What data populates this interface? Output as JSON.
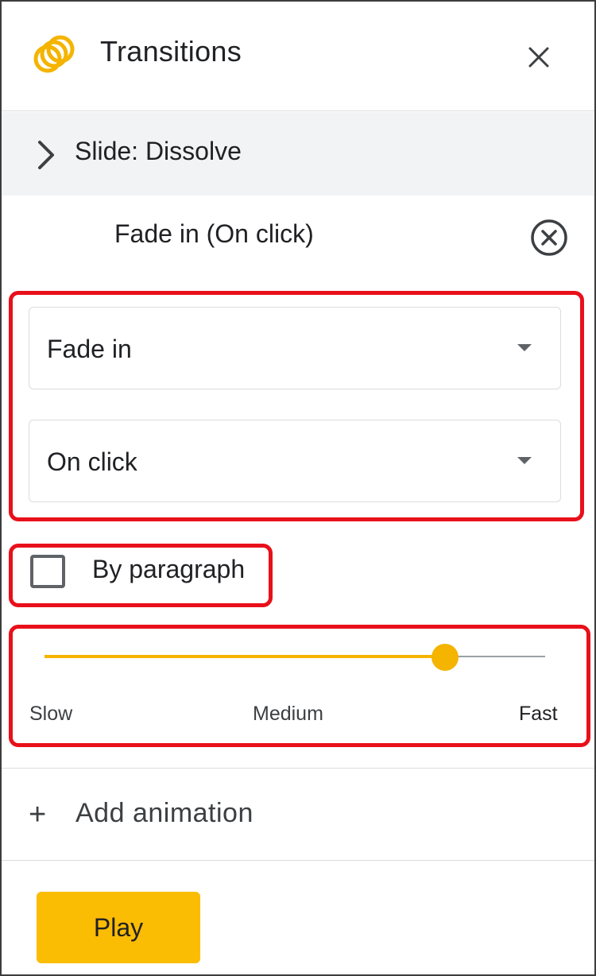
{
  "header": {
    "title": "Transitions",
    "icon": "transitions-icon",
    "close_icon": "close-icon"
  },
  "slide": {
    "label": "Slide: Dissolve",
    "expand_icon": "chevron-right-icon"
  },
  "animation": {
    "title": "Fade in  (On click)",
    "remove_icon": "circle-close-icon",
    "effect_select": {
      "value": "Fade in"
    },
    "trigger_select": {
      "value": "On click"
    },
    "by_paragraph": {
      "label": "By paragraph",
      "checked": false
    },
    "speed": {
      "value": 0.8,
      "labels": {
        "slow": "Slow",
        "medium": "Medium",
        "fast": "Fast"
      }
    }
  },
  "add_animation": {
    "label": "Add animation",
    "icon": "plus-icon"
  },
  "play_button": {
    "label": "Play"
  },
  "colors": {
    "accent": "#fbbc04",
    "highlight": "#e8101a",
    "panel_gray": "#f1f3f4"
  }
}
